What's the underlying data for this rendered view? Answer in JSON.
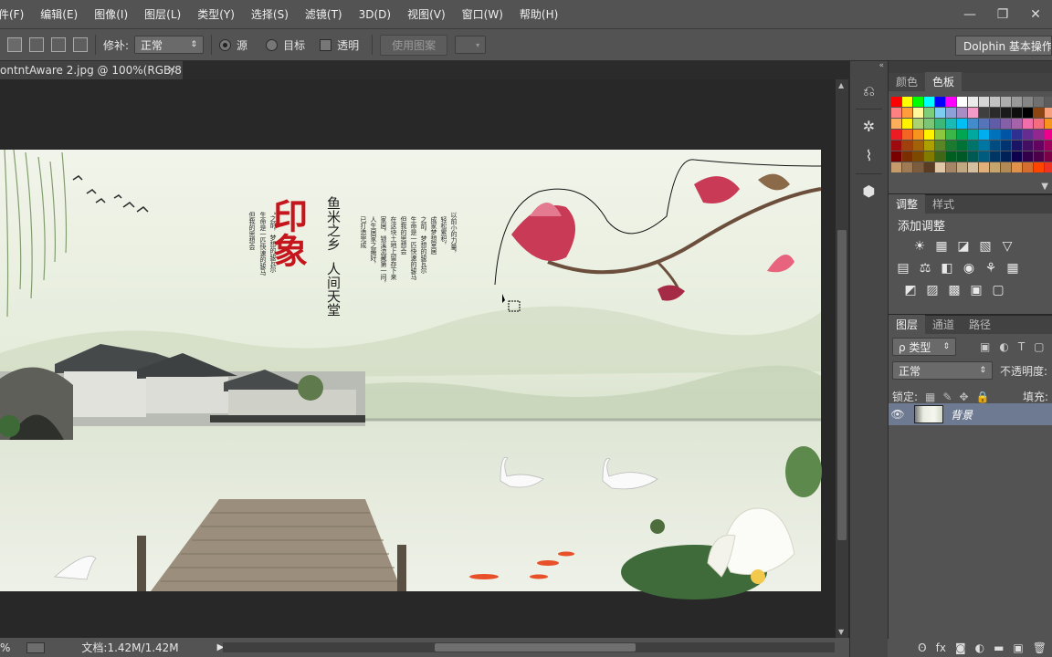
{
  "menu": [
    "件(F)",
    "编辑(E)",
    "图像(I)",
    "图层(L)",
    "类型(Y)",
    "选择(S)",
    "滤镜(T)",
    "3D(D)",
    "视图(V)",
    "窗口(W)",
    "帮助(H)"
  ],
  "window_controls": {
    "minimize": "—",
    "restore": "❐",
    "close": "✕"
  },
  "options": {
    "patch_label": "修补:",
    "patch_mode": "正常",
    "radio_source": "源",
    "radio_target": "目标",
    "transparent_label": "透明",
    "use_pattern_button": "使用图案",
    "workspace": "Dolphin 基本操作轴"
  },
  "document": {
    "tab_title": "ontntAware 2.jpg @ 100%(RGB/8)",
    "close_glyph": "×"
  },
  "artwork": {
    "title_red": "印象",
    "line1": "鱼米之乡",
    "line2": "人间天堂",
    "col1": "但我的思想会",
    "col2": "生命是一匹快速的骏马",
    "col3": "“之前，梦想的骏瓦尔",
    "col4": "以前小的力量，",
    "col5": "轻松累积，",
    "col6": "成家梦想室居",
    "col7": "之前，梦想的骏瓦尔",
    "col8": "生命是一匹快速的骏马",
    "col9": "但我的思想会",
    "col10": "在这块土地上留存下来",
    "col11": "家居，锁溪流藏第一间，",
    "col12": "人生居家之最好，",
    "col13": "已打造完成"
  },
  "status": {
    "zoom": "%",
    "doc_size": "文档:1.42M/1.42M"
  },
  "swatches_panel": {
    "tabs": [
      "颜色",
      "色板"
    ],
    "active": "色板",
    "colors": [
      "#ff0000",
      "#ffff00",
      "#00ff00",
      "#00ffff",
      "#0000ff",
      "#ff00ff",
      "#ffffff",
      "#ebebeb",
      "#d6d6d6",
      "#c2c2c2",
      "#adadad",
      "#999999",
      "#858585",
      "#707070",
      "#5c5c5c",
      "#ff8080",
      "#ff9d3c",
      "#fff799",
      "#7dcc79",
      "#7ccdf0",
      "#8da0d8",
      "#a88cc4",
      "#f39bc6",
      "#3f3f3f",
      "#2a2a2a",
      "#1a1a1a",
      "#0d0d0d",
      "#000000",
      "#8b4513",
      "#f6a07c",
      "#fbaf5d",
      "#fff200",
      "#acd373",
      "#7cc576",
      "#3bb878",
      "#1abbb4",
      "#00bff3",
      "#438ccb",
      "#5574b9",
      "#605ca8",
      "#855fa8",
      "#a763a9",
      "#f06ea9",
      "#f26d7d",
      "#f7941d",
      "#ed1c24",
      "#f26522",
      "#f7941d",
      "#fff200",
      "#8dc63f",
      "#39b54a",
      "#00a651",
      "#00a99d",
      "#00aeef",
      "#0072bc",
      "#0054a6",
      "#2e3192",
      "#662d91",
      "#92278f",
      "#ec008c",
      "#9e0b0f",
      "#a0410d",
      "#a3620a",
      "#aba000",
      "#598527",
      "#1a7b30",
      "#007236",
      "#00746b",
      "#0076a3",
      "#004b80",
      "#003471",
      "#1b1464",
      "#440e62",
      "#630460",
      "#9e005d",
      "#790000",
      "#7b2e00",
      "#7d4900",
      "#827b00",
      "#406618",
      "#005e20",
      "#005826",
      "#005952",
      "#005b7f",
      "#003663",
      "#002157",
      "#0d004c",
      "#32004b",
      "#4b0049",
      "#7b0046",
      "#c69c6d",
      "#9e7b54",
      "#7c5c3e",
      "#5a3c25",
      "#e0c7a7",
      "#a48666",
      "#c0a882",
      "#d4bfa0",
      "#e2b07b",
      "#c7a56f",
      "#b28a53",
      "#e0924a",
      "#d56d2e",
      "#ff4400",
      "#ee3322"
    ]
  },
  "adjustments_panel": {
    "tabs": [
      "调整",
      "样式"
    ],
    "active": "调整",
    "heading": "添加调整",
    "row1": [
      "☀",
      "▦",
      "◪",
      "▧",
      "▽"
    ],
    "row2": [
      "▤",
      "⚖",
      "◧",
      "◉",
      "⚘",
      "▦"
    ],
    "row3": [
      "◩",
      "▨",
      "▩",
      "▣",
      "▢"
    ]
  },
  "layers_panel": {
    "tabs": [
      "图层",
      "通道",
      "路径"
    ],
    "active": "图层",
    "filter_label": "ρ 类型",
    "blend_mode": "正常",
    "opacity_label": "不透明度:",
    "lock_label": "锁定:",
    "fill_label": "填充:",
    "layer_name": "背景"
  },
  "bottom_icons": [
    "ʘ",
    "fx",
    "◙",
    "◐",
    "▬",
    "▣",
    "🗑"
  ]
}
